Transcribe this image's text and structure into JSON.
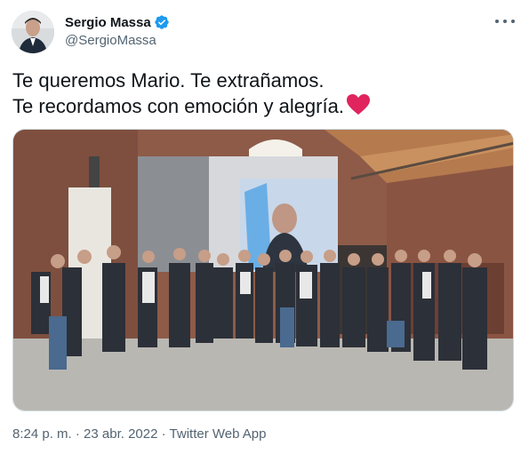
{
  "author": {
    "display_name": "Sergio Massa",
    "handle": "@SergioMassa",
    "verified": true
  },
  "header": {
    "more_icon": "more-horizontal-icon"
  },
  "tweet": {
    "lines": [
      "Te queremos Mario. Te extrañamos.",
      "Te recordamos con emoción y alegría."
    ],
    "emoji": "red-heart-icon"
  },
  "media": {
    "type": "photo"
  },
  "footer": {
    "time": "8:24 p. m.",
    "separator1": "·",
    "date": "23 abr. 2022",
    "separator2": "·",
    "source": "Twitter Web App"
  },
  "colors": {
    "text_primary": "#0f1419",
    "text_secondary": "#536471",
    "verified_blue": "#1d9bf0",
    "heart_red": "#e0245e"
  }
}
